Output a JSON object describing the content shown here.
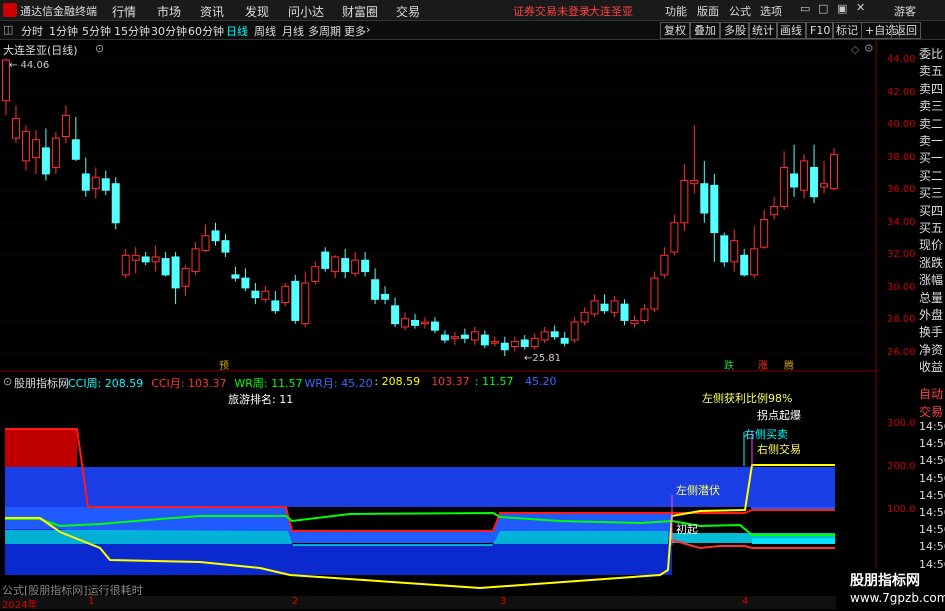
{
  "app": {
    "name": "通达信金融终端"
  },
  "menu": {
    "items": [
      "行情",
      "市场",
      "资讯",
      "发现",
      "问小达",
      "财富圈",
      "交易"
    ],
    "warning": "证券交易未登录",
    "stock_name": "大连圣亚",
    "right": [
      "功能",
      "版面",
      "公式",
      "选项"
    ],
    "guest": "游客"
  },
  "tabs": {
    "items": [
      "分时",
      "1分钟",
      "5分钟",
      "15分钟",
      "30分钟",
      "60分钟",
      "日线",
      "周线",
      "月线",
      "多周期",
      "更多"
    ],
    "active": "日线"
  },
  "toolbar": {
    "buttons": [
      "复权",
      "叠加",
      "多股",
      "统计",
      "画线",
      "F10",
      "标记",
      "+自选",
      "返回"
    ]
  },
  "chart": {
    "title": "大连圣亚(日线)",
    "high_label": "44.06",
    "low_label": "25.81"
  },
  "price_scale": [
    "44.00",
    "42.00",
    "40.00",
    "38.00",
    "36.00",
    "34.00",
    "32.00",
    "30.00",
    "28.00",
    "26.00"
  ],
  "right_panel": [
    "委比",
    "卖五",
    "卖四",
    "卖三",
    "卖二",
    "卖一",
    "买一",
    "买二",
    "买三",
    "买四",
    "买五",
    "现价",
    "涨跌",
    "涨幅",
    "总量",
    "外盘",
    "换手",
    "净资",
    "收益"
  ],
  "right_panel_lower": [
    "自动",
    "交易"
  ],
  "lower_ticks": [
    "14:56",
    "14:56",
    "14:56",
    "14:56",
    "14:56",
    "14:56",
    "14:56",
    "14:56",
    "14:56",
    "14:56"
  ],
  "indicator": {
    "name": "股朋指标网",
    "legend": [
      {
        "label": "CCI周: 208.59",
        "color": "#00ffff"
      },
      {
        "label": "CCI月: 103.37",
        "color": "#ff3030"
      },
      {
        "label": "WR周: 11.57",
        "color": "#00ff00"
      },
      {
        "label": "WR月: 45.20",
        "color": "#3a6bff"
      },
      {
        "label": ": 208.59",
        "color": "#ffff00"
      },
      {
        "label": "103.37",
        "color": "#ff3030"
      },
      {
        "label": ": 11.57",
        "color": "#00ff00"
      },
      {
        "label": "45.20",
        "color": "#3a6bff"
      }
    ],
    "rank_text": "旅游排名: 11",
    "scale": [
      "300.0",
      "200.0",
      "100.0"
    ],
    "annotations": {
      "left_profit": "左侧获利比例98%",
      "breakout": "拐点起爆",
      "right_buy": "右侧买卖",
      "right_trade": "右侧交易",
      "left_lurk": "左侧潜伏",
      "start": "初起"
    },
    "markers": {
      "yu": "预",
      "die": "跌",
      "zhang": "涨",
      "teng": "腾"
    }
  },
  "footer": {
    "text": "公式[股朋指标网]运行很耗时"
  },
  "dates": [
    "2024年",
    "1",
    "2",
    "3",
    "4"
  ],
  "watermark": {
    "title": "股朋指标网",
    "url": "www.7gpzb.com"
  },
  "chart_data": {
    "type": "candlestick",
    "ylim": [
      25,
      45
    ],
    "candles": [
      [
        41.5,
        44.0,
        44.1,
        40.6
      ],
      [
        39.2,
        40.4,
        41.2,
        38.9
      ],
      [
        37.8,
        39.6,
        40.0,
        37.2
      ],
      [
        38.0,
        39.1,
        39.7,
        37.0
      ],
      [
        38.6,
        37.0,
        39.8,
        36.6
      ],
      [
        37.4,
        39.2,
        39.6,
        37.0
      ],
      [
        39.3,
        40.6,
        41.2,
        38.9
      ],
      [
        39.1,
        37.9,
        40.5,
        37.8
      ],
      [
        37.0,
        36.0,
        38.0,
        35.6
      ],
      [
        36.1,
        36.8,
        37.4,
        35.5
      ],
      [
        36.7,
        36.0,
        37.2,
        35.7
      ],
      [
        36.4,
        34.0,
        36.8,
        33.6
      ],
      [
        30.8,
        32.0,
        32.4,
        30.6
      ],
      [
        31.7,
        32.0,
        32.5,
        30.9
      ],
      [
        31.9,
        31.6,
        32.2,
        31.4
      ],
      [
        31.6,
        31.9,
        32.6,
        31.0
      ],
      [
        31.8,
        30.8,
        32.2,
        30.7
      ],
      [
        31.9,
        30.0,
        32.2,
        29.0
      ],
      [
        30.1,
        31.2,
        31.4,
        29.5
      ],
      [
        31.0,
        32.4,
        32.8,
        30.8
      ],
      [
        32.3,
        33.2,
        33.9,
        32.2
      ],
      [
        33.5,
        32.9,
        34.0,
        32.6
      ],
      [
        32.9,
        32.2,
        33.3,
        31.9
      ],
      [
        30.8,
        30.6,
        31.3,
        30.4
      ],
      [
        30.6,
        30.0,
        31.2,
        29.8
      ],
      [
        29.8,
        29.4,
        30.3,
        29.0
      ],
      [
        29.3,
        29.8,
        30.1,
        29.1
      ],
      [
        29.2,
        28.6,
        29.8,
        28.4
      ],
      [
        29.1,
        30.1,
        30.3,
        28.9
      ],
      [
        30.4,
        28.0,
        30.8,
        27.8
      ],
      [
        27.8,
        30.3,
        31.0,
        27.6
      ],
      [
        30.4,
        31.3,
        31.6,
        30.2
      ],
      [
        32.2,
        31.2,
        32.5,
        31.0
      ],
      [
        31.0,
        31.9,
        32.0,
        30.6
      ],
      [
        31.8,
        31.0,
        32.4,
        30.6
      ],
      [
        30.9,
        31.7,
        32.2,
        30.7
      ],
      [
        31.7,
        31.0,
        32.2,
        30.7
      ],
      [
        30.5,
        29.3,
        31.2,
        29.0
      ],
      [
        29.6,
        29.3,
        30.1,
        29.0
      ],
      [
        28.9,
        27.8,
        29.4,
        27.6
      ],
      [
        27.6,
        28.1,
        28.5,
        27.4
      ],
      [
        28.0,
        27.7,
        28.4,
        27.5
      ],
      [
        27.8,
        27.9,
        28.2,
        27.5
      ],
      [
        27.9,
        27.4,
        28.2,
        27.2
      ],
      [
        27.1,
        26.8,
        27.4,
        26.6
      ],
      [
        26.9,
        27.0,
        27.3,
        26.5
      ],
      [
        27.1,
        26.9,
        27.5,
        26.6
      ],
      [
        26.8,
        27.3,
        27.6,
        26.5
      ],
      [
        27.1,
        26.5,
        27.4,
        26.3
      ],
      [
        26.6,
        26.7,
        27.0,
        26.4
      ],
      [
        26.6,
        26.2,
        27.0,
        25.8
      ],
      [
        26.4,
        26.7,
        27.0,
        26.1
      ],
      [
        26.8,
        26.4,
        27.1,
        26.2
      ],
      [
        26.4,
        26.9,
        27.2,
        26.2
      ],
      [
        26.8,
        27.3,
        27.6,
        26.6
      ],
      [
        27.3,
        27.0,
        27.7,
        26.8
      ],
      [
        26.9,
        26.6,
        27.3,
        26.4
      ],
      [
        26.8,
        27.9,
        28.2,
        26.6
      ],
      [
        27.9,
        28.5,
        28.8,
        27.7
      ],
      [
        28.4,
        29.2,
        29.6,
        28.2
      ],
      [
        29.0,
        28.6,
        29.6,
        28.4
      ],
      [
        28.5,
        29.2,
        29.5,
        28.2
      ],
      [
        29.0,
        28.0,
        29.3,
        27.7
      ],
      [
        27.8,
        28.0,
        28.3,
        27.6
      ],
      [
        28.0,
        28.7,
        29.0,
        27.8
      ],
      [
        28.7,
        30.6,
        31.0,
        28.5
      ],
      [
        30.8,
        32.0,
        32.5,
        30.6
      ],
      [
        32.2,
        34.0,
        34.5,
        32.0
      ],
      [
        34.0,
        36.6,
        37.6,
        33.5
      ],
      [
        36.4,
        36.6,
        40.0,
        35.8
      ],
      [
        36.4,
        34.6,
        37.8,
        34.0
      ],
      [
        36.3,
        33.4,
        37.0,
        31.6
      ],
      [
        33.2,
        31.6,
        33.4,
        31.3
      ],
      [
        31.6,
        32.9,
        33.6,
        31.0
      ],
      [
        32.0,
        30.8,
        32.4,
        30.7
      ],
      [
        30.8,
        32.4,
        33.8,
        30.6
      ],
      [
        32.5,
        34.2,
        34.8,
        32.4
      ],
      [
        34.5,
        35.0,
        35.6,
        34.2
      ],
      [
        35.0,
        37.4,
        38.4,
        34.8
      ],
      [
        37.0,
        36.2,
        38.8,
        35.6
      ],
      [
        36.0,
        37.8,
        38.2,
        35.5
      ],
      [
        37.4,
        35.6,
        38.8,
        35.2
      ],
      [
        36.2,
        36.4,
        37.8,
        35.8
      ],
      [
        36.1,
        38.2,
        38.6,
        36.0
      ]
    ]
  }
}
